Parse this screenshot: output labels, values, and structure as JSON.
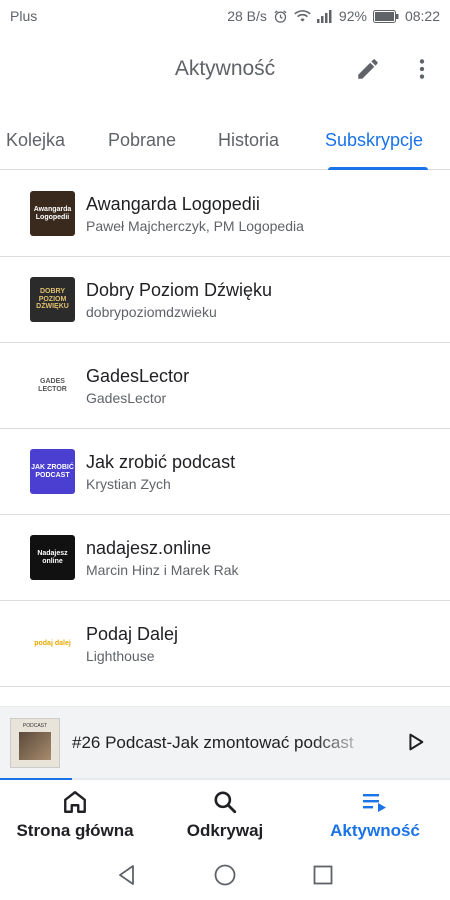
{
  "status_bar": {
    "carrier": "Plus",
    "speed": "28 B/s",
    "battery": "92%",
    "time": "08:22"
  },
  "header": {
    "title": "Aktywność",
    "edit_icon": "pencil-icon",
    "more_icon": "more-vert-icon"
  },
  "tabs": [
    {
      "label": "Kolejka",
      "active": false
    },
    {
      "label": "Pobrane",
      "active": false
    },
    {
      "label": "Historia",
      "active": false
    },
    {
      "label": "Subskrypcje",
      "active": true
    }
  ],
  "subscriptions": [
    {
      "title": "Awangarda Logopedii",
      "author": "Paweł Majcherczyk, PM Logopedia",
      "thumb_text": "Awangarda Logopedii",
      "thumb_bg": "#3a2a1e",
      "thumb_fg": "#ffffff"
    },
    {
      "title": "Dobry Poziom Dźwięku",
      "author": "dobrypoziomdzwieku",
      "thumb_text": "DOBRY POZIOM DŹWIĘKU",
      "thumb_bg": "#2b2b2b",
      "thumb_fg": "#e0c070"
    },
    {
      "title": "GadesLector",
      "author": "GadesLector",
      "thumb_text": "GADES LECTOR",
      "thumb_bg": "#ffffff",
      "thumb_fg": "#555555"
    },
    {
      "title": "Jak zrobić podcast",
      "author": "Krystian Zych",
      "thumb_text": "JAK ZROBIĆ PODCAST",
      "thumb_bg": "#4a3fd1",
      "thumb_fg": "#ffffff"
    },
    {
      "title": "nadajesz.online",
      "author": "Marcin Hinz i Marek Rak",
      "thumb_text": "Nadajesz online",
      "thumb_bg": "#111111",
      "thumb_fg": "#ffffff"
    },
    {
      "title": "Podaj Dalej",
      "author": "Lighthouse",
      "thumb_text": "podaj dalej",
      "thumb_bg": "#ffffff",
      "thumb_fg": "#e8a800"
    }
  ],
  "mini_player": {
    "title": "#26 Podcast-Jak zmontować podcast",
    "thumb_label": "PODCAST",
    "progress": 0.16
  },
  "bottom_nav": [
    {
      "label": "Strona główna",
      "icon": "home-icon",
      "active": false
    },
    {
      "label": "Odkrywaj",
      "icon": "search-icon",
      "active": false
    },
    {
      "label": "Aktywność",
      "icon": "activity-icon",
      "active": true
    }
  ],
  "colors": {
    "accent": "#1a73e8",
    "text_primary": "#202124",
    "text_secondary": "#5f6368"
  }
}
